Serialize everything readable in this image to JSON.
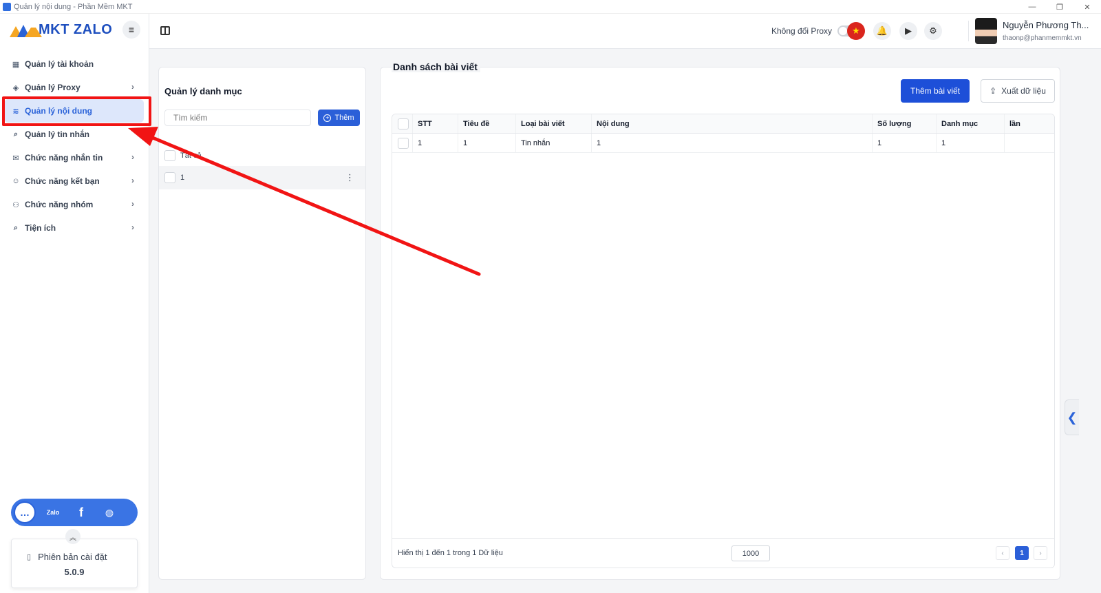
{
  "window": {
    "title": "Quản lý nội dung - Phần Mềm MKT",
    "controls": [
      "—",
      "❐",
      "✕"
    ]
  },
  "brand": {
    "logo_text": "MKT ZALO",
    "menu_icon": "hamburger-icon"
  },
  "sidebar": {
    "items": [
      {
        "label": "Quản lý tài khoản",
        "icon": "grid-icon",
        "glyph": "▦",
        "has_children": false,
        "active": false
      },
      {
        "label": "Quản lý Proxy",
        "icon": "layers-icon",
        "glyph": "◈",
        "has_children": true,
        "active": false
      },
      {
        "label": "Quản lý nội dung",
        "icon": "wave-icon",
        "glyph": "≋",
        "has_children": false,
        "active": true
      },
      {
        "label": "Quản lý tin nhắn",
        "icon": "search-message-icon",
        "glyph": "⌕",
        "has_children": false,
        "active": false
      },
      {
        "label": "Chức năng nhắn tin",
        "icon": "chat-icon",
        "glyph": "✉",
        "has_children": true,
        "active": false
      },
      {
        "label": "Chức năng kết bạn",
        "icon": "add-friend-icon",
        "glyph": "☺",
        "has_children": true,
        "active": false
      },
      {
        "label": "Chức năng nhóm",
        "icon": "group-icon",
        "glyph": "⚇",
        "has_children": true,
        "active": false
      },
      {
        "label": "Tiện ích",
        "icon": "utility-icon",
        "glyph": "⌕",
        "has_children": true,
        "active": false
      }
    ],
    "chevron": "›",
    "social": [
      {
        "name": "support-chat-icon",
        "glyph": "…"
      },
      {
        "name": "zalo-icon",
        "glyph": "Zalo"
      },
      {
        "name": "facebook-icon",
        "glyph": "f"
      },
      {
        "name": "globe-icon",
        "glyph": "◍"
      }
    ],
    "version": {
      "label": "Phiên bản cài đặt",
      "number": "5.0.9",
      "collapse_glyph": "︽"
    }
  },
  "header": {
    "proxy_label": "Không đổi Proxy",
    "proxy_enabled": false,
    "flag_glyph": "★",
    "bell_glyph": "🔔",
    "play_glyph": "▶",
    "gear_glyph": "⚙",
    "user": {
      "name": "Nguyễn Phương Th...",
      "email": "thaonp@phanmemmkt.vn"
    }
  },
  "category_panel": {
    "title": "Quản lý danh mục",
    "search_placeholder": "Tìm kiếm",
    "add_label": "Thêm",
    "items": [
      {
        "label": "Tất cả"
      },
      {
        "label": "1"
      }
    ],
    "kebab": "⋮"
  },
  "posts_panel": {
    "title": "Danh sách bài viết",
    "add_post_label": "Thêm bài viết",
    "export_label": "Xuất dữ liệu",
    "columns": [
      "STT",
      "Tiêu đề",
      "Loại bài viết",
      "Nội dung",
      "Số lượng",
      "Danh mục",
      "lần"
    ],
    "rows": [
      [
        "1",
        "1",
        "Tin nhắn",
        "1",
        "1",
        "1",
        ""
      ]
    ],
    "footer_info": "Hiển thị 1 đến 1 trong 1 Dữ liệu",
    "page_size": "1000",
    "pagination": {
      "prev": "‹",
      "current": "1",
      "next": "›"
    }
  },
  "colors": {
    "accent": "#2b5fd8",
    "annotation": "#f11414"
  }
}
